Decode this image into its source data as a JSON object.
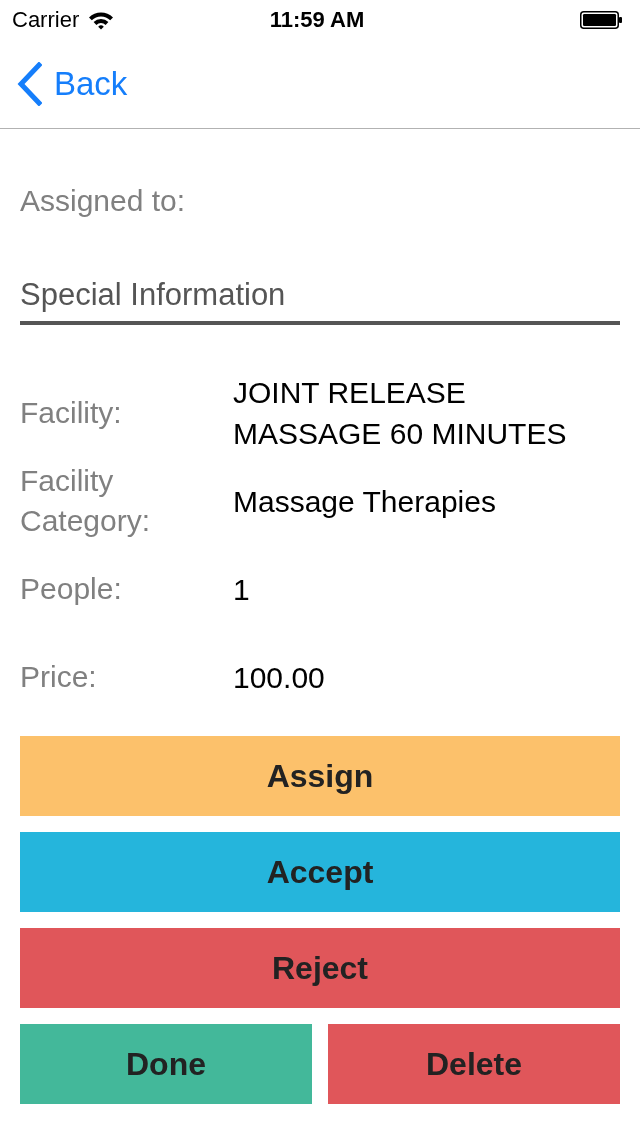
{
  "status_bar": {
    "carrier": "Carrier",
    "time": "11:59 AM"
  },
  "nav_bar": {
    "back_label": "Back"
  },
  "assigned_to": {
    "label": "Assigned to:"
  },
  "section": {
    "title": "Special Information"
  },
  "details": [
    {
      "label": "Facility:",
      "value": "JOINT RELEASE MASSAGE 60 MINUTES"
    },
    {
      "label": "Facility Category:",
      "value": "Massage Therapies"
    },
    {
      "label": "People:",
      "value": "1"
    },
    {
      "label": "Price:",
      "value": "100.00"
    }
  ],
  "action_rows": [
    [
      {
        "label": "Assign",
        "color": "#fcc16b"
      }
    ],
    [
      {
        "label": "Accept",
        "color": "#25b5dc"
      }
    ],
    [
      {
        "label": "Reject",
        "color": "#e0565a"
      }
    ],
    [
      {
        "label": "Done",
        "color": "#43b89a"
      },
      {
        "label": "Delete",
        "color": "#e0565a"
      }
    ]
  ]
}
